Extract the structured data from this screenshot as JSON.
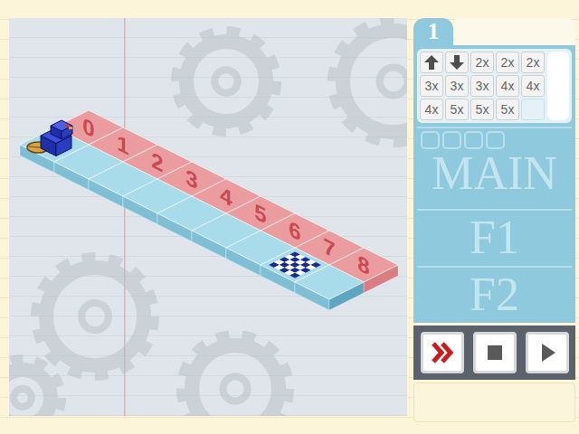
{
  "level_tab": {
    "label": "1",
    "selected": true
  },
  "board": {
    "tiles": [
      {
        "label": "0",
        "robot": true,
        "goal": false
      },
      {
        "label": "1",
        "robot": false,
        "goal": false
      },
      {
        "label": "2",
        "robot": false,
        "goal": false
      },
      {
        "label": "3",
        "robot": false,
        "goal": false
      },
      {
        "label": "4",
        "robot": false,
        "goal": false
      },
      {
        "label": "5",
        "robot": false,
        "goal": false
      },
      {
        "label": "6",
        "robot": false,
        "goal": false
      },
      {
        "label": "7",
        "robot": false,
        "goal": true
      },
      {
        "label": "8",
        "robot": false,
        "goal": false
      }
    ]
  },
  "palette": [
    {
      "kind": "forward"
    },
    {
      "kind": "back"
    },
    {
      "kind": "repeat",
      "label": "2x"
    },
    {
      "kind": "repeat",
      "label": "2x"
    },
    {
      "kind": "repeat",
      "label": "2x"
    },
    {
      "kind": "repeat",
      "label": "3x"
    },
    {
      "kind": "repeat",
      "label": "3x"
    },
    {
      "kind": "repeat",
      "label": "3x"
    },
    {
      "kind": "repeat",
      "label": "4x"
    },
    {
      "kind": "repeat",
      "label": "4x"
    },
    {
      "kind": "repeat",
      "label": "4x"
    },
    {
      "kind": "repeat",
      "label": "5x"
    },
    {
      "kind": "repeat",
      "label": "5x"
    },
    {
      "kind": "repeat",
      "label": "5x"
    },
    {
      "kind": "empty"
    }
  ],
  "procedures": [
    {
      "label": "MAIN",
      "slots": [
        {
          "empty": true
        },
        {
          "empty": true
        },
        {
          "empty": true
        },
        {
          "empty": true
        }
      ]
    },
    {
      "label": "F1",
      "slots": []
    },
    {
      "label": "F2",
      "slots": []
    }
  ],
  "controls": [
    {
      "kind": "fast-forward"
    },
    {
      "kind": "stop"
    },
    {
      "kind": "play"
    }
  ]
}
